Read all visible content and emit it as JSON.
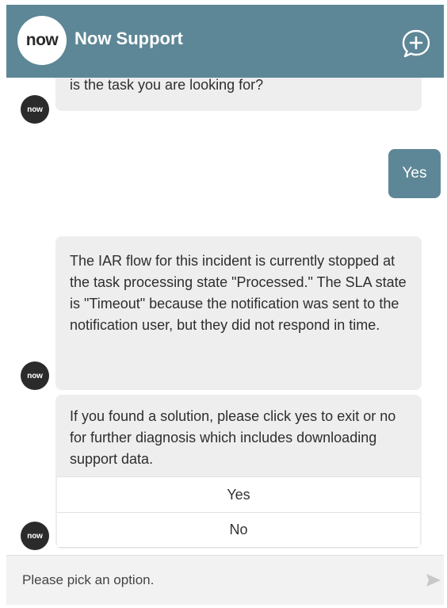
{
  "header": {
    "logo_text": "now",
    "title": "Now Support",
    "new_chat_icon": "chat-plus-icon",
    "color": "#5d8796"
  },
  "transcript": {
    "bot_avatar_text": "now",
    "messages": [
      {
        "from": "bot",
        "text": "is the task you are looking for?"
      },
      {
        "from": "user",
        "text": "Yes"
      },
      {
        "from": "bot",
        "text": "The IAR flow for this incident is currently stopped at the task processing state \"Processed.\" The SLA state is \"Timeout\" because the notification was sent to the notification user, but they did not respond in time."
      },
      {
        "from": "bot",
        "text": "If you found a solution, please click yes to exit or no for further diagnosis which includes downloading support data.",
        "options": [
          "Yes",
          "No"
        ]
      }
    ]
  },
  "composer": {
    "placeholder": "Please pick an option.",
    "send_icon": "send-icon"
  }
}
